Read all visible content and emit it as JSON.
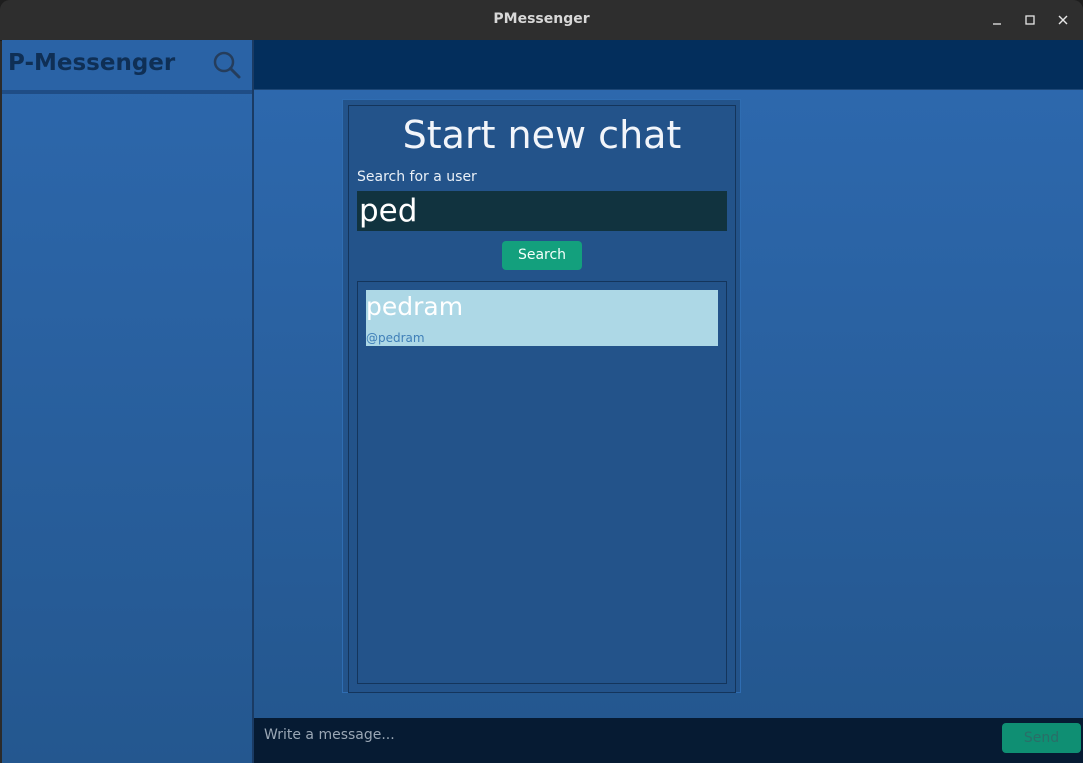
{
  "window": {
    "title": "PMessenger",
    "controls": [
      "minimize",
      "maximize",
      "close"
    ]
  },
  "sidebar": {
    "app_name": "P-Messenger",
    "search_icon": "search-icon"
  },
  "dialog": {
    "title": "Start new chat",
    "search_label": "Search for a user",
    "search_value": "ped",
    "search_button": "Search",
    "results": [
      {
        "name": "pedram",
        "handle": "@pedram"
      }
    ]
  },
  "composer": {
    "placeholder": "Write a message...",
    "send_label": "Send"
  },
  "colors": {
    "accent": "#13a07d",
    "sidebar_bg": "#2d68ad",
    "topbar_bg": "#032e5c",
    "composer_bg": "#061b33",
    "result_highlight": "#add8e6"
  }
}
